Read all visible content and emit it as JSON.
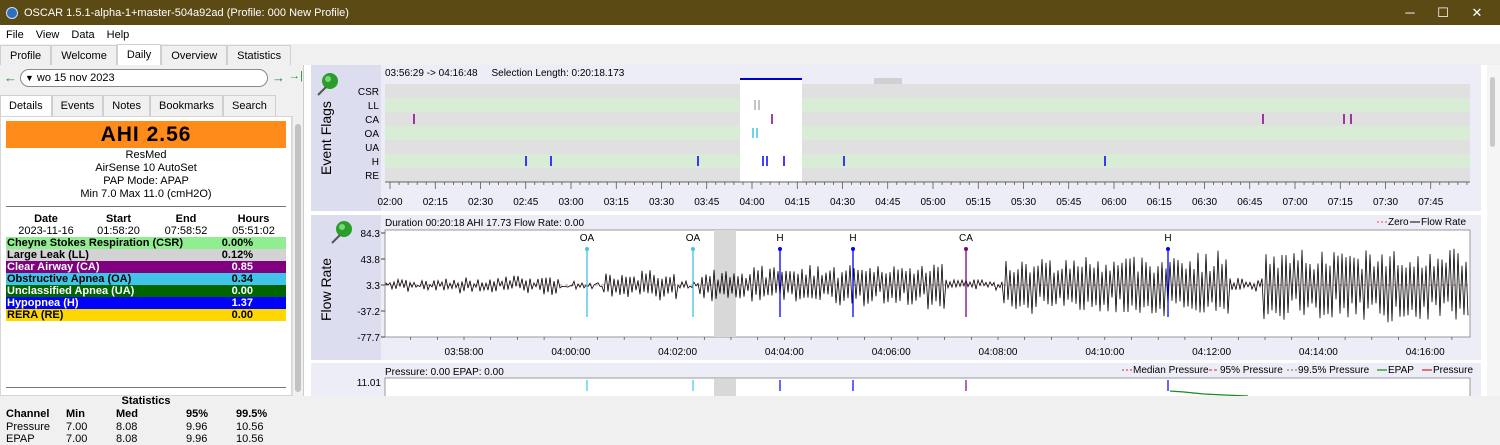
{
  "window": {
    "title": "OSCAR 1.5.1-alpha-1+master-504a92ad (Profile: 000 New Profile)",
    "minimize": "─",
    "maximize": "☐",
    "close": "✕"
  },
  "menu": [
    "File",
    "View",
    "Data",
    "Help"
  ],
  "tabs": [
    "Profile",
    "Welcome",
    "Daily",
    "Overview",
    "Statistics"
  ],
  "active_tab": "Daily",
  "datenav": {
    "back_arrow": "←",
    "date": "wo 15 nov 2023",
    "forward_arrow": "→",
    "jump_end": "→|"
  },
  "subtabs": [
    "Details",
    "Events",
    "Notes",
    "Bookmarks",
    "Search"
  ],
  "summary": {
    "ahi": "AHI 2.56",
    "brand": "ResMed",
    "model": "AirSense 10 AutoSet",
    "mode": "PAP Mode: APAP",
    "pressure": "Min 7.0 Max 11.0 (cmH2O)"
  },
  "session": {
    "headers": [
      "Date",
      "Start",
      "End",
      "Hours"
    ],
    "values": [
      "2023-11-16",
      "01:58:20",
      "07:58:52",
      "05:51:02"
    ]
  },
  "events": [
    {
      "label": "Cheyne Stokes Respiration (CSR)",
      "value": "0.00%",
      "bg": "#90ee90",
      "fg": "#000000"
    },
    {
      "label": "Large Leak (LL)",
      "value": "0.12%",
      "bg": "#d3d3d3",
      "fg": "#000000"
    },
    {
      "label": "Clear Airway (CA)",
      "value": "0.85",
      "bg": "#800080",
      "fg": "#ffffff"
    },
    {
      "label": "Obstructive Apnea (OA)",
      "value": "0.34",
      "bg": "#40c4e8",
      "fg": "#000000"
    },
    {
      "label": "Unclassified Apnea (UA)",
      "value": "0.00",
      "bg": "#006400",
      "fg": "#ffffff"
    },
    {
      "label": "Hypopnea (H)",
      "value": "1.37",
      "bg": "#0000ff",
      "fg": "#ffffff"
    },
    {
      "label": "RERA (RE)",
      "value": "0.00",
      "bg": "#ffd700",
      "fg": "#000000"
    }
  ],
  "statistics": {
    "title": "Statistics",
    "headers": [
      "Channel",
      "Min",
      "Med",
      "95%",
      "99.5%"
    ],
    "rows": [
      [
        "Pressure",
        "7.00",
        "8.08",
        "9.96",
        "10.56"
      ],
      [
        "EPAP",
        "7.00",
        "8.08",
        "9.96",
        "10.56"
      ]
    ]
  },
  "event_flags": {
    "ylabel": "Event Flags",
    "header": "03:56:29 -> 04:16:48     Selection Length: 0:20:18.173",
    "rows": [
      "CSR",
      "LL",
      "CA",
      "OA",
      "UA",
      "H",
      "RE"
    ],
    "ticks": [
      "02:00",
      "02:15",
      "02:30",
      "02:45",
      "03:00",
      "03:15",
      "03:30",
      "03:45",
      "04:00",
      "04:15",
      "04:30",
      "04:45",
      "05:00",
      "05:15",
      "05:30",
      "05:45",
      "06:00",
      "06:15",
      "06:30",
      "06:45",
      "07:00",
      "07:15",
      "07:30",
      "07:45"
    ]
  },
  "flow_rate": {
    "ylabel": "Flow Rate",
    "header": "Duration 00:20:18 AHI 17.73 Flow Rate: 0.00",
    "legend": [
      "Zero",
      "Flow Rate"
    ],
    "yticks": [
      "84.3",
      "43.8",
      "3.3",
      "-37.2",
      "-77.7"
    ],
    "xticks": [
      "03:58:00",
      "04:00:00",
      "04:02:00",
      "04:04:00",
      "04:06:00",
      "04:08:00",
      "04:10:00",
      "04:12:00",
      "04:14:00",
      "04:16:00"
    ],
    "markers": [
      {
        "label": "OA",
        "color": "#40c4e8"
      },
      {
        "label": "OA",
        "color": "#40c4e8"
      },
      {
        "label": "H",
        "color": "#0000ff"
      },
      {
        "label": "H",
        "color": "#0000ff"
      },
      {
        "label": "CA",
        "color": "#800080"
      },
      {
        "label": "H",
        "color": "#0000ff"
      }
    ]
  },
  "pressure": {
    "header": "Pressure: 0.00 EPAP: 0.00",
    "legend": [
      "Median Pressure",
      "95% Pressure",
      "99.5% Pressure",
      "EPAP",
      "Pressure"
    ],
    "ytick": "11.01"
  }
}
